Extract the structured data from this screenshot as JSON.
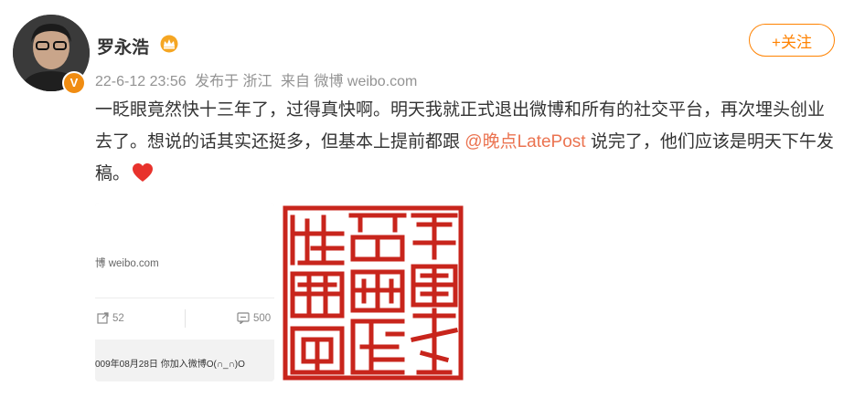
{
  "user": {
    "name": "罗永浩",
    "verified_badge": "V"
  },
  "meta": {
    "time": "22-6-12 23:56",
    "location": "发布于 浙江",
    "source": "来自 微博 weibo.com"
  },
  "follow_label": "+关注",
  "post": {
    "text_before": "一眨眼竟然快十三年了，过得真快啊。明天我就正式退出微博和所有的社交平台，再次埋头创业去了。想说的话其实还挺多，但基本上提前都跟 ",
    "mention": "@晚点LatePost",
    "text_after": " 说完了，他们应该是明天下午发稿。"
  },
  "thumb1": {
    "source_text": "博 weibo.com",
    "forward_count": "52",
    "comment_count": "500",
    "date_text": "009年08月28日 你加入微博O(∩_∩)O"
  },
  "colors": {
    "accent": "#ff8200",
    "mention": "#eb7350",
    "seal_red": "#c8251c"
  },
  "icons": [
    "crown-icon",
    "heart-icon",
    "forward-icon",
    "comment-icon",
    "seal-stamp"
  ]
}
